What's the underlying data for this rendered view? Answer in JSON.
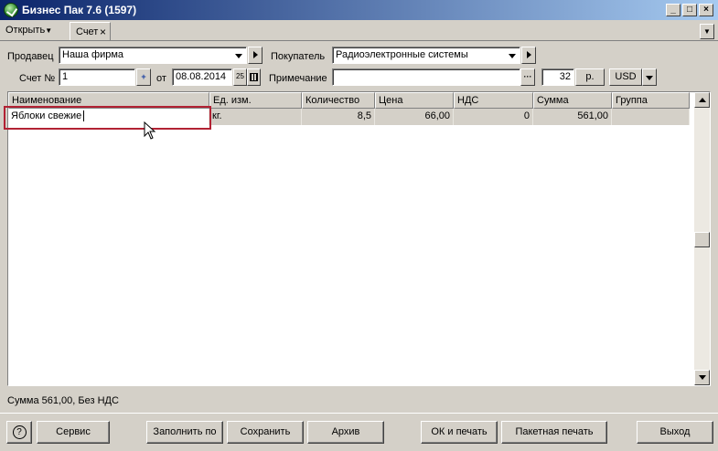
{
  "window": {
    "title": "Бизнес Пак 7.6 (1597)",
    "controls": {
      "minimize": "_",
      "maximize": "□",
      "close": "×"
    }
  },
  "tabs": {
    "open_menu": "Открыть",
    "open_menu_arrow": "▼",
    "active_tab": "Счет",
    "active_tab_close": "×",
    "dropdown_arrow": "▼"
  },
  "form": {
    "seller_label": "Продавец",
    "seller_value": "Наша фирма",
    "buyer_label": "Покупатель",
    "buyer_value": "Радиоэлектронные системы",
    "invoice_no_label": "Счет №",
    "invoice_no_value": "1",
    "date_from_label": "от",
    "date_value": "08.08.2014",
    "date_btn": "25",
    "note_label": "Примечание",
    "note_value": "",
    "note_btn": "···",
    "rate_value": "32",
    "rate_unit": "р.",
    "currency": "USD"
  },
  "grid": {
    "columns": [
      "Наименование",
      "Ед. изм.",
      "Количество",
      "Цена",
      "НДС",
      "Сумма",
      "Группа"
    ],
    "rows": [
      {
        "name": "Яблоки свежие",
        "unit": "кг.",
        "qty": "8,5",
        "price": "66,00",
        "vat": "0",
        "sum": "561,00",
        "group": ""
      }
    ]
  },
  "status": {
    "text": "Сумма 561,00, Без НДС"
  },
  "buttons": {
    "help": "?",
    "service": "Сервис",
    "fill_by": "Заполнить по",
    "save": "Сохранить",
    "archive": "Архив",
    "ok_print": "ОК и печать",
    "batch_print": "Пакетная печать",
    "exit": "Выход"
  },
  "colors": {
    "titlebar_start": "#0a246a",
    "titlebar_end": "#a6caf0",
    "face": "#d4d0c8",
    "highlight_box": "#b22234"
  },
  "icons": {
    "app": "app-logo-icon",
    "cursor": "mouse-pointer-icon"
  }
}
